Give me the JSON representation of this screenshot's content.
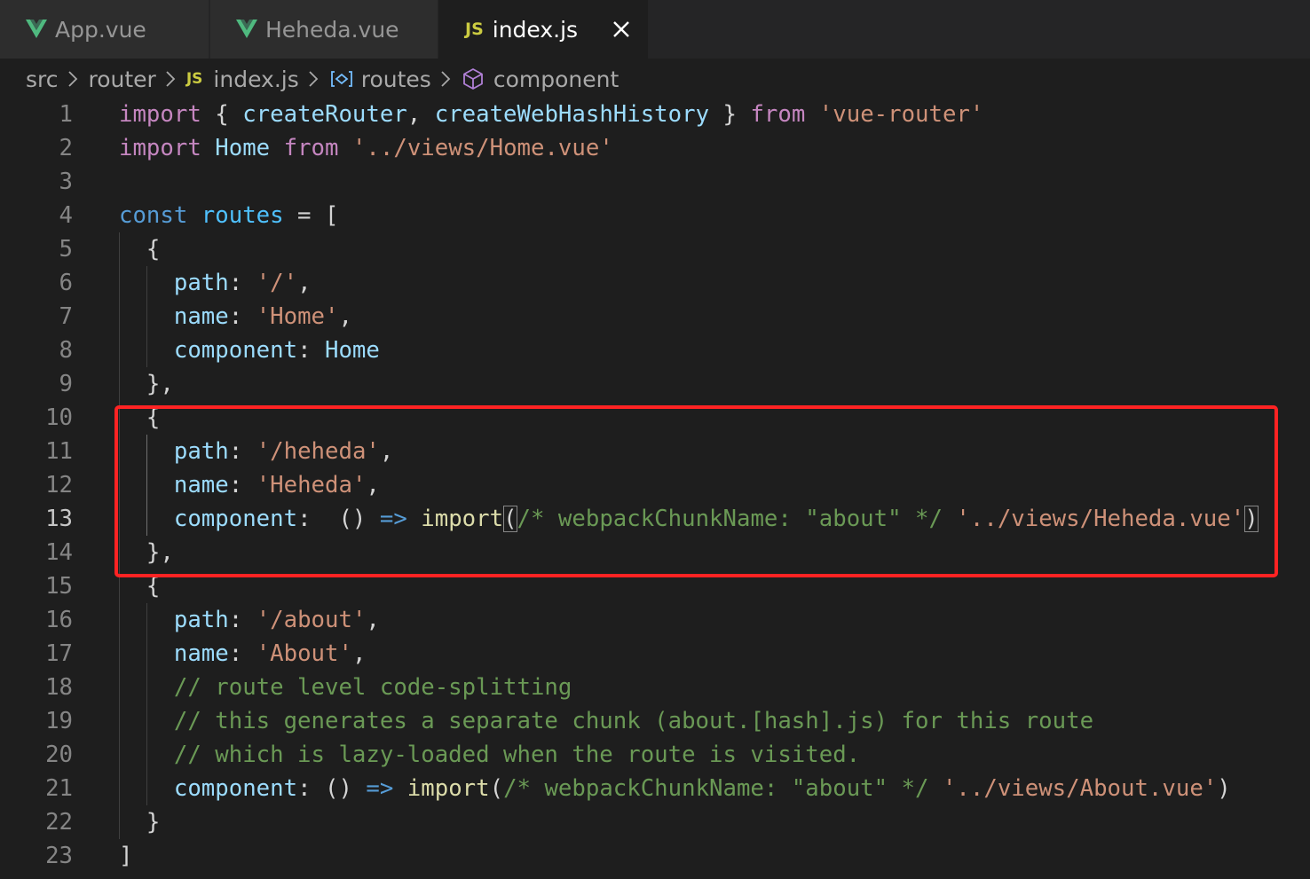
{
  "tabs": [
    {
      "label": "App.vue",
      "icon": "vue-icon",
      "active": false
    },
    {
      "label": "Heheda.vue",
      "icon": "vue-icon",
      "active": false
    },
    {
      "label": "index.js",
      "icon": "js-icon",
      "icon_text": "JS",
      "active": true,
      "close_icon": "close-icon"
    }
  ],
  "breadcrumb": [
    {
      "label": "src"
    },
    {
      "label": "router"
    },
    {
      "label": "index.js",
      "icon": "js-icon",
      "icon_text": "JS"
    },
    {
      "label": "routes",
      "icon": "variable-icon"
    },
    {
      "label": "component",
      "icon": "cube-icon"
    }
  ],
  "editor": {
    "current_line": 13,
    "line_numbers": [
      "1",
      "2",
      "3",
      "4",
      "5",
      "6",
      "7",
      "8",
      "9",
      "10",
      "11",
      "12",
      "13",
      "14",
      "15",
      "16",
      "17",
      "18",
      "19",
      "20",
      "21",
      "22",
      "23"
    ],
    "lines": [
      [
        [
          "kw",
          "import"
        ],
        [
          "op",
          " { "
        ],
        [
          "id",
          "createRouter"
        ],
        [
          "op",
          ", "
        ],
        [
          "id",
          "createWebHashHistory"
        ],
        [
          "op",
          " } "
        ],
        [
          "kw",
          "from"
        ],
        [
          "op",
          " "
        ],
        [
          "str",
          "'vue-router'"
        ]
      ],
      [
        [
          "kw",
          "import"
        ],
        [
          "op",
          " "
        ],
        [
          "id",
          "Home"
        ],
        [
          "op",
          " "
        ],
        [
          "kw",
          "from"
        ],
        [
          "op",
          " "
        ],
        [
          "str",
          "'../views/Home.vue'"
        ]
      ],
      [],
      [
        [
          "dk",
          "const"
        ],
        [
          "op",
          " "
        ],
        [
          "var",
          "routes"
        ],
        [
          "op",
          " = ["
        ]
      ],
      [
        [
          "op",
          "  {"
        ]
      ],
      [
        [
          "op",
          "    "
        ],
        [
          "id",
          "path"
        ],
        [
          "op",
          ": "
        ],
        [
          "str",
          "'/'"
        ],
        [
          "op",
          ","
        ]
      ],
      [
        [
          "op",
          "    "
        ],
        [
          "id",
          "name"
        ],
        [
          "op",
          ": "
        ],
        [
          "str",
          "'Home'"
        ],
        [
          "op",
          ","
        ]
      ],
      [
        [
          "op",
          "    "
        ],
        [
          "id",
          "component"
        ],
        [
          "op",
          ": "
        ],
        [
          "id",
          "Home"
        ]
      ],
      [
        [
          "op",
          "  },"
        ]
      ],
      [
        [
          "op",
          "  {"
        ]
      ],
      [
        [
          "op",
          "    "
        ],
        [
          "id",
          "path"
        ],
        [
          "op",
          ": "
        ],
        [
          "str",
          "'/heheda'"
        ],
        [
          "op",
          ","
        ]
      ],
      [
        [
          "op",
          "    "
        ],
        [
          "id",
          "name"
        ],
        [
          "op",
          ": "
        ],
        [
          "str",
          "'Heheda'"
        ],
        [
          "op",
          ","
        ]
      ],
      [
        [
          "op",
          "    "
        ],
        [
          "id",
          "component"
        ],
        [
          "op",
          ":  () "
        ],
        [
          "dk",
          "=>"
        ],
        [
          "op",
          " "
        ],
        [
          "fn",
          "import"
        ],
        [
          "bm",
          "("
        ],
        [
          "cm",
          "/* webpackChunkName: \"about\" */"
        ],
        [
          "op",
          " "
        ],
        [
          "str",
          "'../views/Heheda.vue'"
        ],
        [
          "bm",
          ")"
        ]
      ],
      [
        [
          "op",
          "  },"
        ]
      ],
      [
        [
          "op",
          "  {"
        ]
      ],
      [
        [
          "op",
          "    "
        ],
        [
          "id",
          "path"
        ],
        [
          "op",
          ": "
        ],
        [
          "str",
          "'/about'"
        ],
        [
          "op",
          ","
        ]
      ],
      [
        [
          "op",
          "    "
        ],
        [
          "id",
          "name"
        ],
        [
          "op",
          ": "
        ],
        [
          "str",
          "'About'"
        ],
        [
          "op",
          ","
        ]
      ],
      [
        [
          "op",
          "    "
        ],
        [
          "cm",
          "// route level code-splitting"
        ]
      ],
      [
        [
          "op",
          "    "
        ],
        [
          "cm",
          "// this generates a separate chunk (about.[hash].js) for this route"
        ]
      ],
      [
        [
          "op",
          "    "
        ],
        [
          "cm",
          "// which is lazy-loaded when the route is visited."
        ]
      ],
      [
        [
          "op",
          "    "
        ],
        [
          "id",
          "component"
        ],
        [
          "op",
          ": () "
        ],
        [
          "dk",
          "=>"
        ],
        [
          "op",
          " "
        ],
        [
          "fn",
          "import"
        ],
        [
          "op",
          "("
        ],
        [
          "cm",
          "/* webpackChunkName: \"about\" */"
        ],
        [
          "op",
          " "
        ],
        [
          "str",
          "'../views/About.vue'"
        ],
        [
          "op",
          ")"
        ]
      ],
      [
        [
          "op",
          "  }"
        ]
      ],
      [
        [
          "op",
          "]"
        ]
      ]
    ]
  },
  "colors": {
    "editor_bg": "#1e1e1e",
    "tabbar_bg": "#252526",
    "keyword": "#c586c0",
    "storage": "#569cd6",
    "variable": "#9cdcfe",
    "const_var": "#4fc1ff",
    "function": "#dcdcaa",
    "string": "#ce9178",
    "comment": "#6a9955",
    "annotation_box": "#ff2323"
  }
}
